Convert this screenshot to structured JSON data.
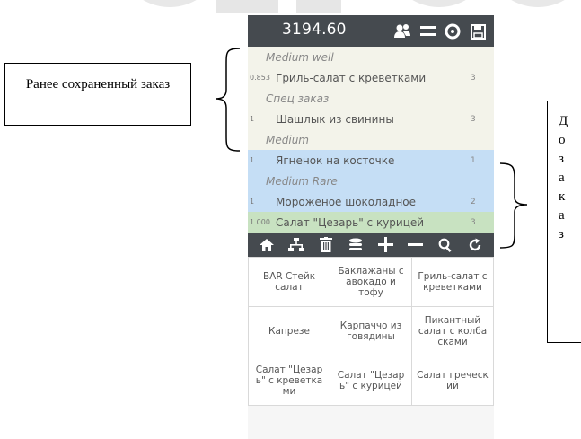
{
  "notes": {
    "left": "Ранее сохраненный заказ",
    "right_letters": [
      "Д",
      "о",
      "з",
      "а",
      "к",
      "а",
      "з"
    ]
  },
  "header": {
    "total": "3194.60",
    "icons": [
      "users-icon",
      "menu-icon",
      "settings-icon",
      "save-icon"
    ]
  },
  "order_rows": [
    {
      "type": "mod",
      "group": "saved",
      "name": "Medium well"
    },
    {
      "type": "item",
      "group": "saved",
      "qty": "0.853",
      "name": "Гриль-салат с креветками",
      "count": "3"
    },
    {
      "type": "mod",
      "group": "saved",
      "name": "Спец заказ"
    },
    {
      "type": "item",
      "group": "saved",
      "qty": "1",
      "name": "Шашлык из свинины",
      "count": "3"
    },
    {
      "type": "mod",
      "group": "saved",
      "name": "Medium"
    },
    {
      "type": "item",
      "group": "added",
      "qty": "1",
      "name": "Ягненок на косточке",
      "count": "1"
    },
    {
      "type": "mod",
      "group": "added",
      "name": "Medium Rare"
    },
    {
      "type": "item",
      "group": "added",
      "qty": "1",
      "name": "Мороженое шоколадное",
      "count": "2"
    },
    {
      "type": "item",
      "group": "selected",
      "qty": "1.000",
      "name": "Салат \"Цезарь\" с курицей",
      "count": "3"
    }
  ],
  "toolbar": [
    "home-icon",
    "split-icon",
    "trash-icon",
    "stack-icon",
    "plus-icon",
    "minus-icon",
    "search-icon",
    "refresh-icon"
  ],
  "menu_items": [
    "BAR Стейк салат",
    "Баклажаны с авокадо и тофу",
    "Гриль-салат с креветками",
    "Капрезе",
    "Карпаччо из говядины",
    "Пикантный салат с колба сками",
    "Салат \"Цезар ь\" с креветка ми",
    "Салат \"Цезар ь\" с курицей",
    "Салат греческ ий"
  ],
  "colors": {
    "topbar": "#454a4f",
    "saved_row": "#f3f3ea",
    "added_row": "#c5def5",
    "selected_row": "#c8e2c1"
  }
}
